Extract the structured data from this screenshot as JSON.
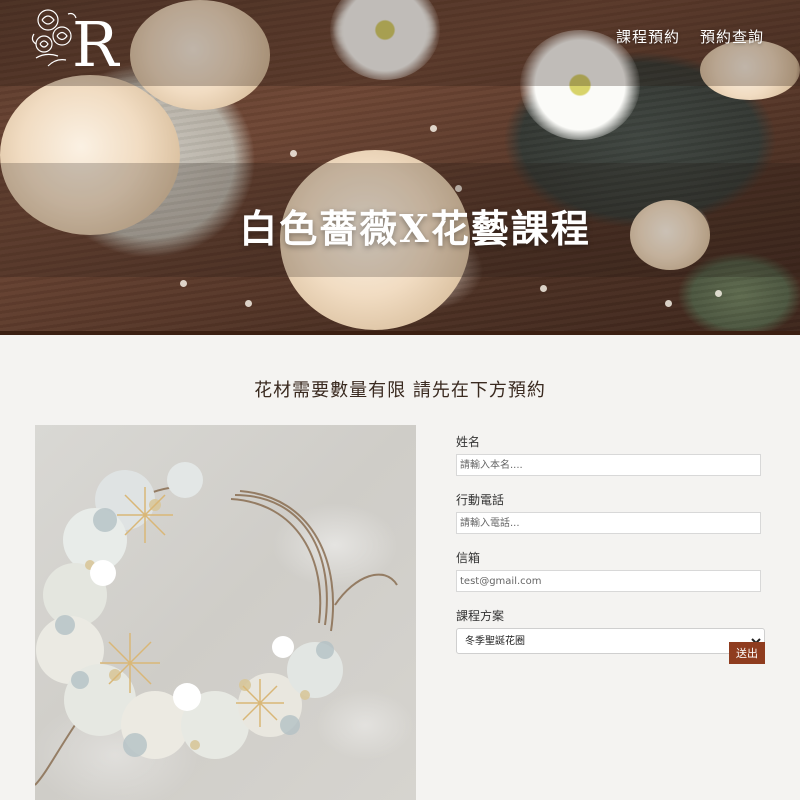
{
  "nav": {
    "logo_letter": "R",
    "links": [
      {
        "label": "課程預約"
      },
      {
        "label": "預約查詢"
      }
    ]
  },
  "hero": {
    "title": "白色薔薇X花藝課程"
  },
  "main": {
    "heading": "花材需要數量有限 請先在下方預約"
  },
  "form": {
    "name_label": "姓名",
    "name_placeholder": "請輸入本名....",
    "phone_label": "行動電話",
    "phone_placeholder": "請輸入電話...",
    "email_label": "信箱",
    "email_placeholder": "test@gmail.com",
    "plan_label": "課程方案",
    "plan_selected": "冬季聖誕花圈",
    "submit_label": "送出"
  },
  "colors": {
    "accent": "#8f3c1f",
    "heading_text": "#3a2a20",
    "page_bg": "#f4f3f1"
  },
  "icons": {
    "logo": "rose-monogram-logo",
    "select_arrow": "chevron-down-icon"
  }
}
